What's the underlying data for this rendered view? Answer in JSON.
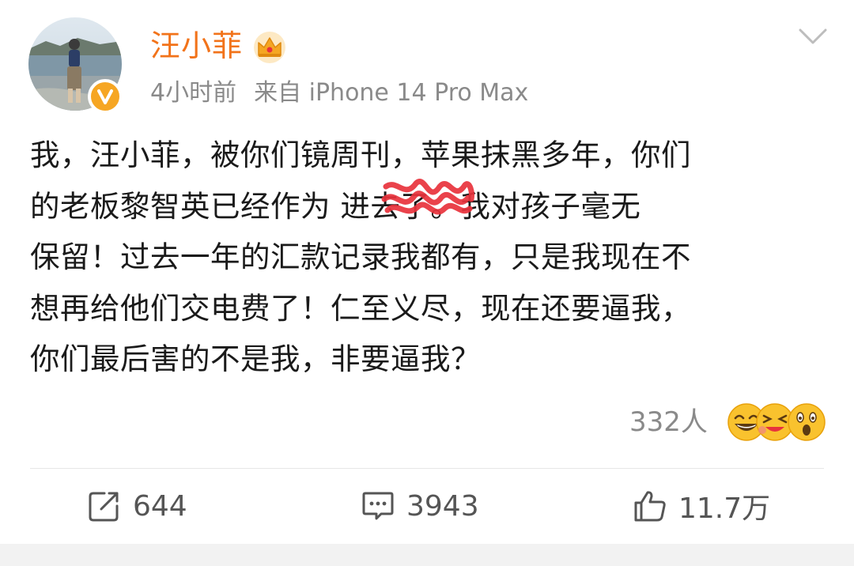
{
  "post": {
    "author": {
      "name": "汪小菲",
      "verified": true,
      "badge_icon": "crown-icon"
    },
    "meta": {
      "time": "4小时前",
      "source": "来自 iPhone 14 Pro Max"
    },
    "content_lines": [
      "我，汪小菲，被你们镜周刊，苹果抹黑多年，你们",
      "的老板黎智英已经作为      进去了。我对孩子毫无",
      "保留！过去一年的汇款记录我都有，只是我现在不",
      "想再给他们交电费了！仁至义尽，现在还要逼我，",
      "你们最后害的不是我，非要逼我？"
    ],
    "reactions": {
      "count": "332人",
      "emoji_icons": [
        "grinning-icon",
        "laughing-icon",
        "surprised-icon"
      ]
    },
    "actions": {
      "repost": "644",
      "comment": "3943",
      "like": "11.7万"
    },
    "colors": {
      "username": "#f2731a",
      "meta": "#8a8a8a",
      "badge": "#f6a623",
      "scribble": "#e8323c"
    }
  }
}
